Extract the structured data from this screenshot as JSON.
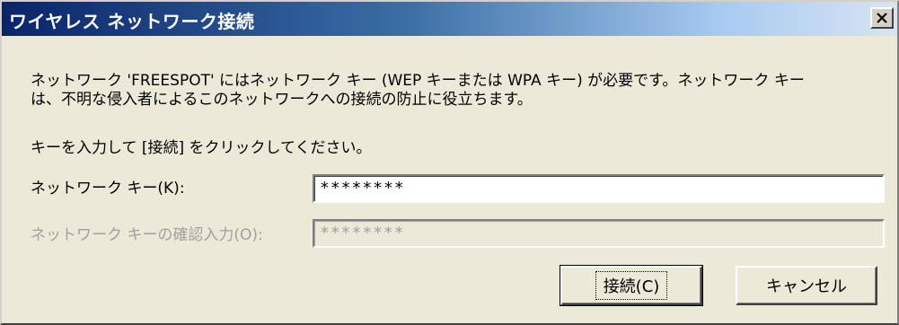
{
  "window": {
    "title": "ワイヤレス ネットワーク接続",
    "close_icon": "close-icon"
  },
  "content": {
    "message": "ネットワーク 'FREESPOT' にはネットワーク キー (WEP キーまたは WPA キー) が必要です。ネットワーク キー\nは、不明な侵入者によるこのネットワークへの接続の防止に役立ちます。",
    "instruction": "キーを入力して [接続] をクリックしてください。",
    "network_key_label": "ネットワーク キー(K):",
    "network_key_value": "********",
    "confirm_key_label": "ネットワーク キーの確認入力(O):",
    "confirm_key_value": "********"
  },
  "buttons": {
    "connect_label": "接続(C)",
    "cancel_label": "キャンセル"
  },
  "colors": {
    "title_gradient_start": "#0a246a",
    "title_gradient_end": "#d7e4f2",
    "dialog_bg": "#ece9d8",
    "disabled_text": "#a0a0a0"
  }
}
